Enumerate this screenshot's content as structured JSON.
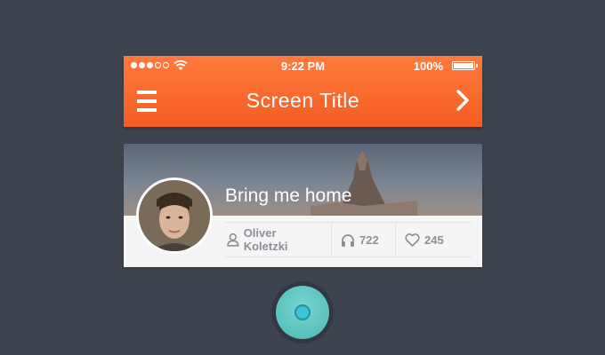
{
  "status_bar": {
    "time": "9:22 PM",
    "battery": "100%",
    "signal_icon": "signal-dots-icon",
    "wifi_icon": "wifi-icon"
  },
  "navbar": {
    "title": "Screen Title",
    "menu_icon": "hamburger-icon",
    "next_icon": "chevron-right-icon",
    "background": "#f6622a"
  },
  "card": {
    "title": "Bring me home",
    "author": "Oliver Koletzki",
    "listens": "722",
    "likes": "245",
    "author_icon": "user-icon",
    "listens_icon": "headphones-icon",
    "likes_icon": "heart-icon"
  },
  "home_button": {
    "icon": "home-button-icon",
    "color": "#5cc6c0"
  }
}
